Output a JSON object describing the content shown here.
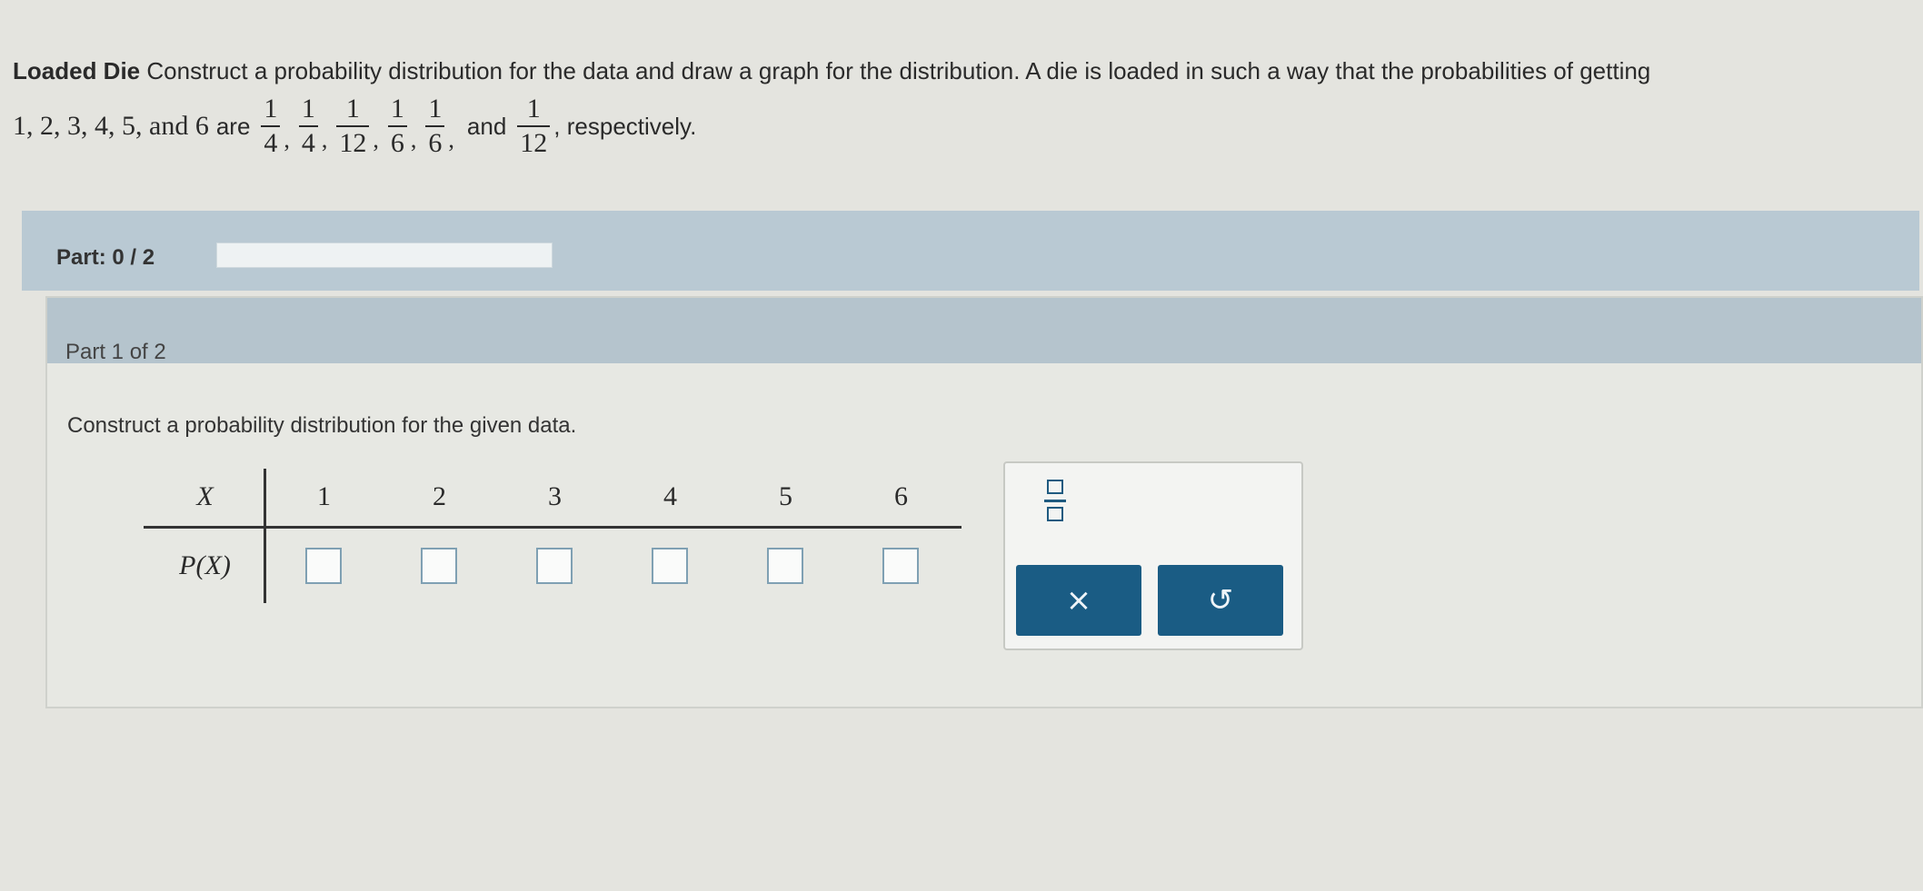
{
  "problem": {
    "title": "Loaded Die",
    "line1": "Construct a probability distribution for the data and draw a graph for the distribution. A die is loaded in such a way that the probabilities of getting",
    "outcomes": "1, 2, 3, 4, 5, and 6",
    "are": "are",
    "fractions": [
      {
        "num": "1",
        "den": "4"
      },
      {
        "num": "1",
        "den": "4"
      },
      {
        "num": "1",
        "den": "12"
      },
      {
        "num": "1",
        "den": "6"
      },
      {
        "num": "1",
        "den": "6"
      },
      {
        "num": "1",
        "den": "12"
      }
    ],
    "comma": ",",
    "and": "and",
    "ending": ", respectively."
  },
  "progress": {
    "label": "Part: 0 / 2",
    "fraction_complete": 0
  },
  "part": {
    "header": "Part 1 of 2",
    "instruction": "Construct a probability distribution for the given data."
  },
  "table": {
    "x_label": "X",
    "p_label": "P(X)",
    "x_values": [
      "1",
      "2",
      "3",
      "4",
      "5",
      "6"
    ],
    "p_values": [
      "",
      "",
      "",
      "",
      "",
      ""
    ]
  },
  "tools": {
    "fraction_icon": "fraction-template-icon",
    "clear_label": "×",
    "undo_label": "↺"
  },
  "colors": {
    "accent": "#1a5c84",
    "part_bar": "#b9c9d3",
    "input_border": "#7fa0b3"
  }
}
